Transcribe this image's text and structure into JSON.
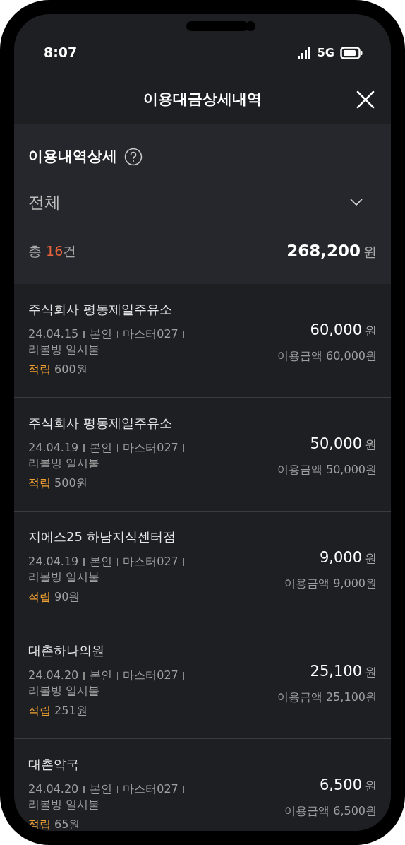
{
  "status_bar": {
    "time": "8:07",
    "network": "5G"
  },
  "header": {
    "title": "이용대금상세내역"
  },
  "summary": {
    "title": "이용내역상세",
    "filter": "전체",
    "count_prefix": "총",
    "count": "16",
    "count_suffix": "건",
    "total": "268,200",
    "total_unit": "원"
  },
  "transactions": [
    {
      "merchant": "주식회사 평동제일주유소",
      "date": "24.04.15",
      "user": "본인",
      "card": "마스터027",
      "plan": "리볼빙 일시불",
      "points_label": "적립",
      "points": "600원",
      "amount": "60,000",
      "unit": "원",
      "usage": "이용금액 60,000원"
    },
    {
      "merchant": "주식회사 평동제일주유소",
      "date": "24.04.19",
      "user": "본인",
      "card": "마스터027",
      "plan": "리볼빙 일시불",
      "points_label": "적립",
      "points": "500원",
      "amount": "50,000",
      "unit": "원",
      "usage": "이용금액 50,000원"
    },
    {
      "merchant": "지에스25 하남지식센터점",
      "date": "24.04.19",
      "user": "본인",
      "card": "마스터027",
      "plan": "리볼빙 일시불",
      "points_label": "적립",
      "points": "90원",
      "amount": "9,000",
      "unit": "원",
      "usage": "이용금액 9,000원"
    },
    {
      "merchant": "대촌하나의원",
      "date": "24.04.20",
      "user": "본인",
      "card": "마스터027",
      "plan": "리볼빙 일시불",
      "points_label": "적립",
      "points": "251원",
      "amount": "25,100",
      "unit": "원",
      "usage": "이용금액 25,100원"
    },
    {
      "merchant": "대촌약국",
      "date": "24.04.20",
      "user": "본인",
      "card": "마스터027",
      "plan": "리볼빙 일시불",
      "points_label": "적립",
      "points": "65원",
      "amount": "6,500",
      "unit": "원",
      "usage": "이용금액 6,500원"
    }
  ]
}
